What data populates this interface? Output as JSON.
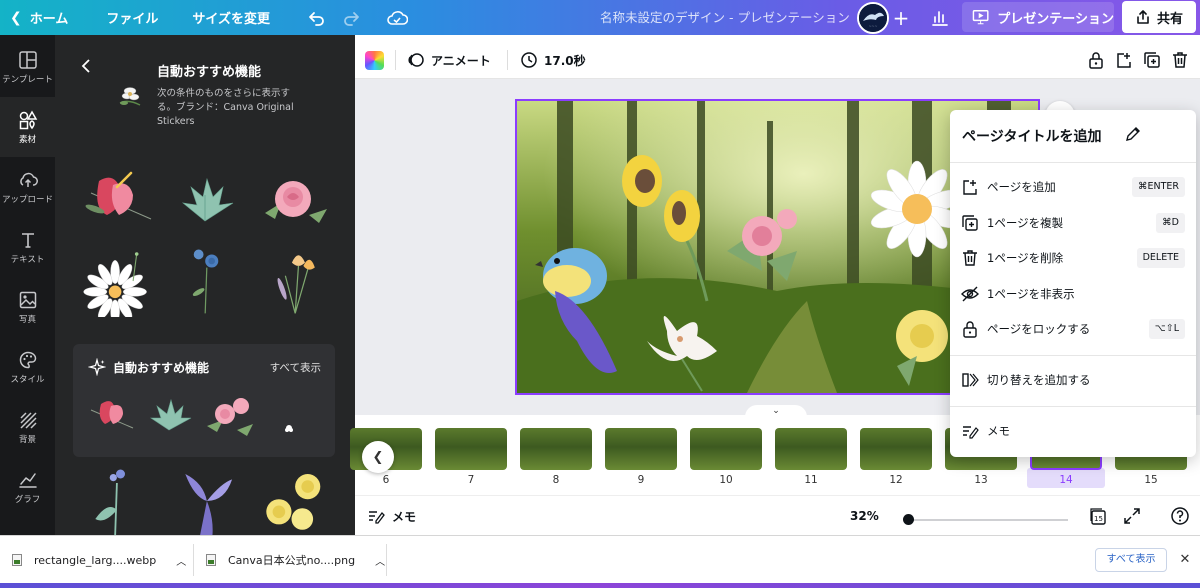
{
  "topbar": {
    "home": "ホーム",
    "file": "ファイル",
    "resize": "サイズを変更",
    "title": "名称未設定のデザイン - プレゼンテーション",
    "present": "プレゼンテーション",
    "share": "共有"
  },
  "rail": [
    {
      "label": "テンプレート",
      "icon": "template-icon"
    },
    {
      "label": "素材",
      "icon": "elements-icon"
    },
    {
      "label": "アップロード",
      "icon": "upload-icon"
    },
    {
      "label": "テキスト",
      "icon": "text-icon"
    },
    {
      "label": "写真",
      "icon": "photo-icon"
    },
    {
      "label": "スタイル",
      "icon": "palette-icon"
    },
    {
      "label": "背景",
      "icon": "background-icon"
    },
    {
      "label": "グラフ",
      "icon": "graph-icon"
    }
  ],
  "panel": {
    "title": "自動おすすめ機能",
    "description": "次の条件のものをさらに表示する。ブランド：Canva Original Stickers",
    "recommend_title": "自動おすすめ機能",
    "see_all": "すべて表示"
  },
  "canvas_toolbar": {
    "animate": "アニメート",
    "duration": "17.0秒"
  },
  "context_menu": {
    "title": "ページタイトルを追加",
    "items": [
      {
        "label": "ページを追加",
        "shortcut": "⌘ENTER",
        "icon": "add-page-icon"
      },
      {
        "label": "1ページを複製",
        "shortcut": "⌘D",
        "icon": "duplicate-icon"
      },
      {
        "label": "1ページを削除",
        "shortcut": "DELETE",
        "icon": "trash-icon"
      },
      {
        "label": "1ページを非表示",
        "shortcut": "",
        "icon": "hide-icon"
      },
      {
        "label": "ページをロックする",
        "shortcut": "⌥⇧L",
        "icon": "lock-icon"
      },
      {
        "label": "切り替えを追加する",
        "shortcut": "",
        "icon": "transition-icon"
      },
      {
        "label": "メモ",
        "shortcut": "",
        "icon": "notes-icon"
      }
    ]
  },
  "filmstrip": {
    "pages": [
      "6",
      "7",
      "8",
      "9",
      "10",
      "11",
      "12",
      "13",
      "14",
      "15"
    ],
    "selected": "14"
  },
  "bottombar": {
    "memo": "メモ",
    "zoom": "32%",
    "zoom_level": 0.32,
    "page_count": "15"
  },
  "downloads": {
    "items": [
      "rectangle_larg....webp",
      "Canva日本公式no....png"
    ],
    "show_all": "すべて表示"
  },
  "colors": {
    "accent": "#8b3dff",
    "rail_bg": "#18191b",
    "panel_bg": "#252627",
    "workspace_bg": "#ebecf0"
  }
}
